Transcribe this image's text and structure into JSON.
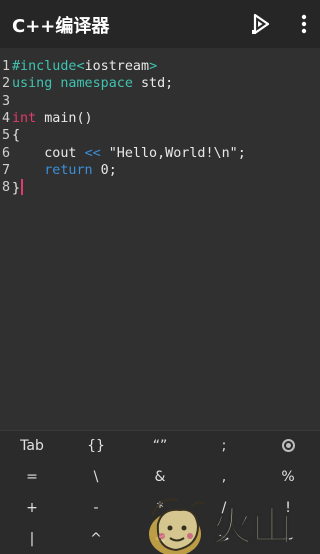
{
  "appbar": {
    "title": "C++编译器",
    "run_icon": "play-run-icon",
    "more_icon": "more-vert-icon"
  },
  "editor": {
    "lines": [
      {
        "n": "1",
        "parts": [
          {
            "t": "#include<",
            "c": "inc"
          },
          {
            "t": "iostream",
            "c": ""
          },
          {
            "t": ">",
            "c": "inc"
          }
        ]
      },
      {
        "n": "2",
        "parts": [
          {
            "t": "using namespace",
            "c": "inc"
          },
          {
            "t": " std;",
            "c": ""
          }
        ]
      },
      {
        "n": "3",
        "parts": []
      },
      {
        "n": "4",
        "parts": [
          {
            "t": "int",
            "c": "kw2"
          },
          {
            "t": " main()",
            "c": ""
          }
        ]
      },
      {
        "n": "5",
        "parts": [
          {
            "t": "{",
            "c": ""
          }
        ]
      },
      {
        "n": "6",
        "parts": [
          {
            "t": "    cout ",
            "c": ""
          },
          {
            "t": "<<",
            "c": "kw"
          },
          {
            "t": " \"Hello,World!\\n\";",
            "c": ""
          }
        ]
      },
      {
        "n": "7",
        "parts": [
          {
            "t": "    ",
            "c": ""
          },
          {
            "t": "return",
            "c": "kw"
          },
          {
            "t": " 0;",
            "c": ""
          }
        ]
      },
      {
        "n": "8",
        "parts": [
          {
            "t": "}",
            "c": ""
          }
        ],
        "cursor": true
      }
    ]
  },
  "keyboard": {
    "rows": [
      [
        "Tab",
        "{}",
        "“”",
        ";",
        "radio"
      ],
      [
        "=",
        "\\",
        "&",
        ",",
        "%"
      ],
      [
        "+",
        "-",
        "*",
        "/",
        "!"
      ],
      [
        "|",
        "^",
        "<",
        ">",
        "~"
      ]
    ],
    "radio_icon": "radio-button-icon"
  },
  "watermark": {
    "text": "火山",
    "icon": "cartoon-logo-watermark"
  }
}
